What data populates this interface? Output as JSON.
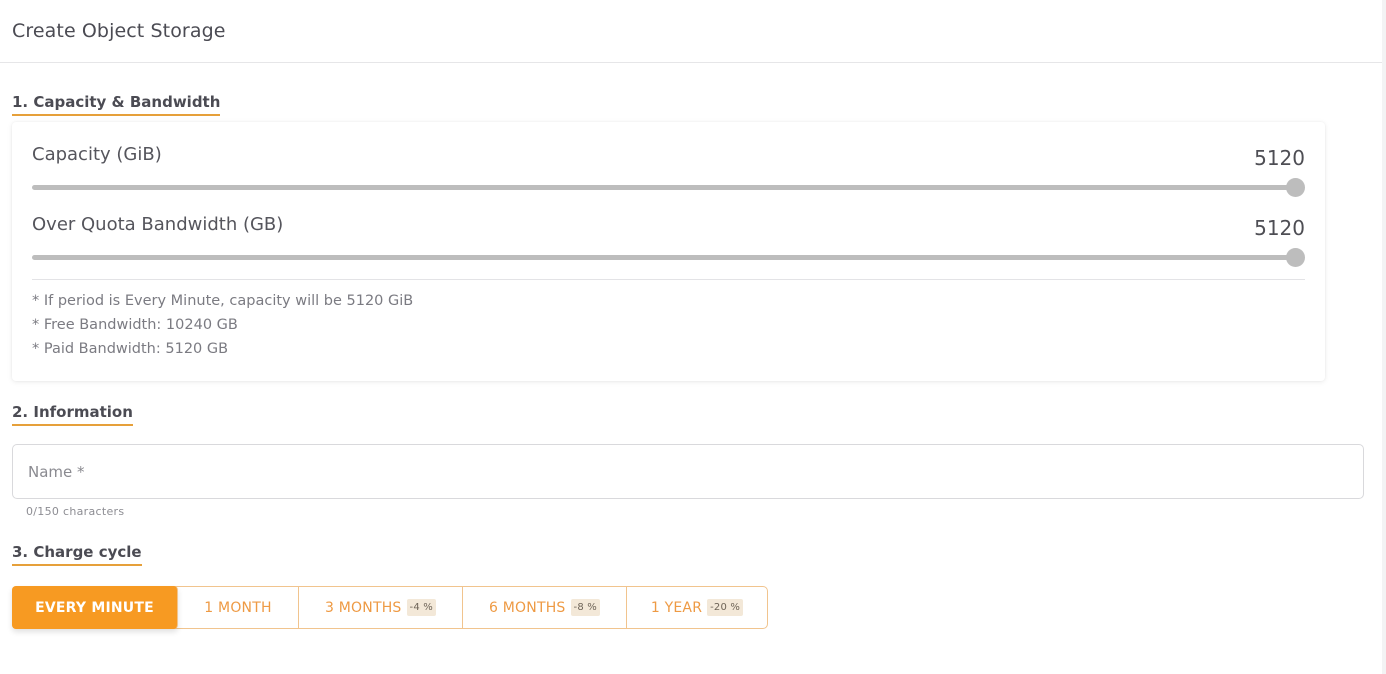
{
  "header": {
    "title": "Create Object Storage"
  },
  "sections": {
    "capacity": {
      "title": "1. Capacity & Bandwidth",
      "sliders": [
        {
          "label": "Capacity (GiB)",
          "value": "5120",
          "fraction": 1.0
        },
        {
          "label": "Over Quota Bandwidth (GB)",
          "value": "5120",
          "fraction": 1.0
        }
      ],
      "notes": [
        "* If period is Every Minute, capacity will be 5120 GiB",
        "* Free Bandwidth: 10240 GB",
        "* Paid Bandwidth: 5120 GB"
      ]
    },
    "information": {
      "title": "2. Information",
      "name_placeholder": "Name *",
      "name_value": "",
      "counter": "0/150 characters"
    },
    "charge_cycle": {
      "title": "3. Charge cycle",
      "options": [
        {
          "label": "EVERY MINUTE",
          "badge": "",
          "active": true
        },
        {
          "label": "1 MONTH",
          "badge": "",
          "active": false
        },
        {
          "label": "3 MONTHS",
          "badge": "-4 %",
          "active": false
        },
        {
          "label": "6 MONTHS",
          "badge": "-8 %",
          "active": false
        },
        {
          "label": "1 YEAR",
          "badge": "-20 %",
          "active": false
        }
      ]
    }
  },
  "colors": {
    "accent": "#f79a22",
    "accent_border": "#f1c48e",
    "underline": "#e6a03a"
  }
}
